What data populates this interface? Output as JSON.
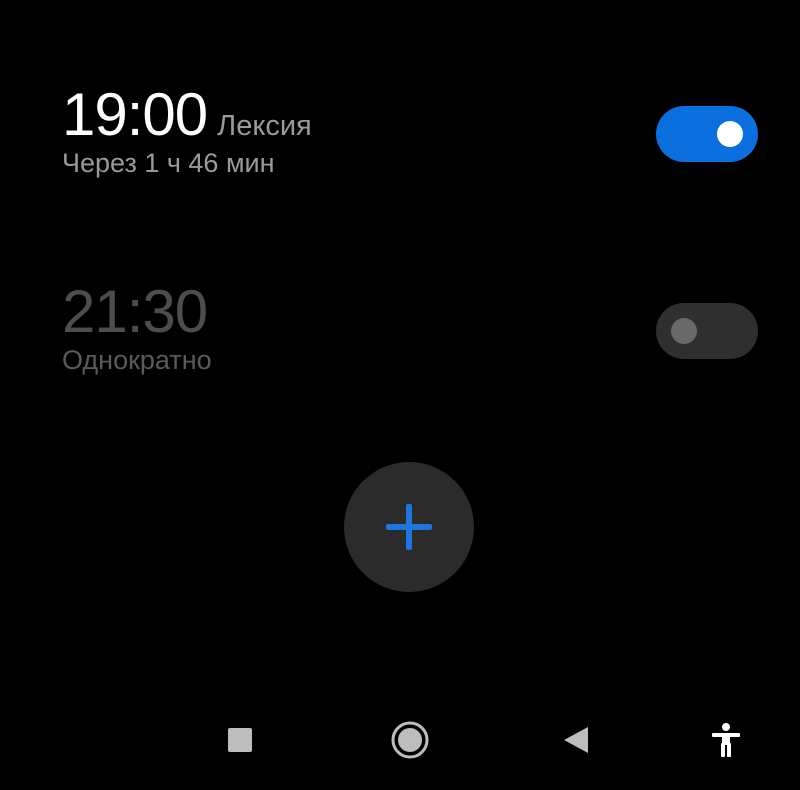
{
  "alarms": [
    {
      "time": "19:00",
      "label": "Лексия",
      "subtitle": "Через 1 ч 46 мин",
      "enabled": true
    },
    {
      "time": "21:30",
      "label": "",
      "subtitle": "Однократно",
      "enabled": false
    }
  ],
  "colors": {
    "accent": "#0b6fe0",
    "background": "#000000",
    "fab_background": "#2b2b2b",
    "toggle_off": "#2f2f2f"
  },
  "fab": {
    "icon": "plus-icon"
  },
  "navbar": {
    "recents_icon": "square-icon",
    "home_icon": "circle-icon",
    "back_icon": "triangle-back-icon",
    "accessibility_icon": "accessibility-icon"
  }
}
